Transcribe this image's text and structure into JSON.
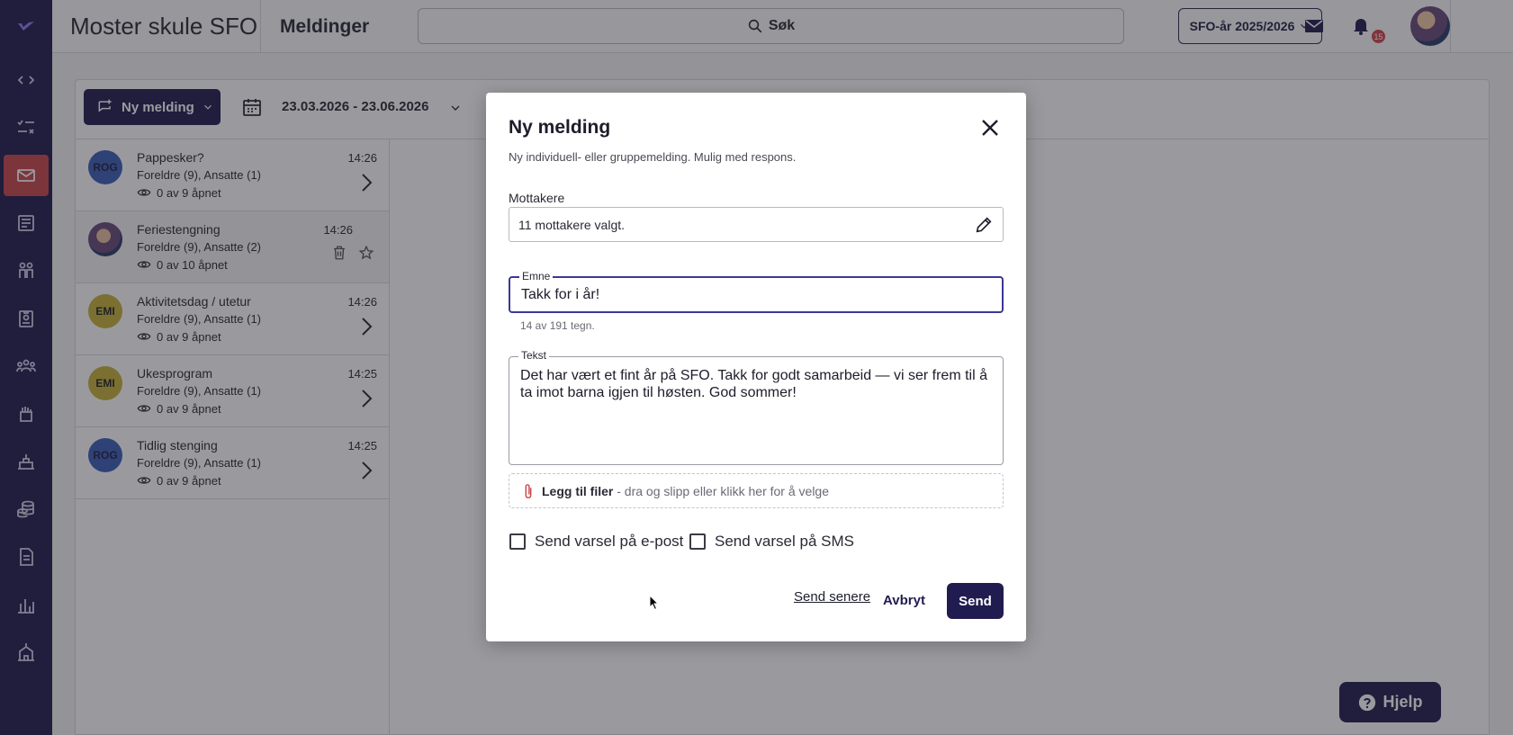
{
  "colors": {
    "sidebar": "#211c4f",
    "active_nav": "#c9474c",
    "primary": "#211c4f",
    "badge": "#d4424d"
  },
  "sidebar": {
    "items": [
      {
        "name": "logo-icon"
      },
      {
        "name": "code-icon"
      },
      {
        "name": "tasks-icon"
      },
      {
        "name": "mail-icon",
        "active": true
      },
      {
        "name": "newspaper-icon"
      },
      {
        "name": "children-icon"
      },
      {
        "name": "badge-icon"
      },
      {
        "name": "groups-icon"
      },
      {
        "name": "hand-icon"
      },
      {
        "name": "activities-icon"
      },
      {
        "name": "coins-icon"
      },
      {
        "name": "document-icon"
      },
      {
        "name": "chart-icon"
      },
      {
        "name": "school-icon"
      }
    ]
  },
  "header": {
    "title": "Moster skule SFO",
    "section": "Meldinger",
    "search_label": "Søk",
    "year_selector": "SFO-år 2025/2026",
    "notification_count": "15"
  },
  "toolbar": {
    "new_message_label": "Ny melding",
    "date_range": "23.03.2026 - 23.06.2026"
  },
  "messages": [
    {
      "avatar": "ROG",
      "avatar_color": "#3d5fb8",
      "title": "Pappesker?",
      "recipients": "Foreldre (9), Ansatte (1)",
      "opened": "0 av 9 åpnet",
      "time": "14:26"
    },
    {
      "avatar": "",
      "avatar_color": "#6a4a7a",
      "title": "Feriestengning",
      "recipients": "Foreldre (9), Ansatte (2)",
      "opened": "0 av 10 åpnet",
      "time": "14:26"
    },
    {
      "avatar": "EMI",
      "avatar_color": "#c7b23a",
      "title": "Aktivitetsdag / utetur",
      "recipients": "Foreldre (9), Ansatte (1)",
      "opened": "0 av 9 åpnet",
      "time": "14:26"
    },
    {
      "avatar": "EMI",
      "avatar_color": "#c7b23a",
      "title": "Ukesprogram",
      "recipients": "Foreldre (9), Ansatte (1)",
      "opened": "0 av 9 åpnet",
      "time": "14:25"
    },
    {
      "avatar": "ROG",
      "avatar_color": "#3d5fb8",
      "title": "Tidlig stenging",
      "recipients": "Foreldre (9), Ansatte (1)",
      "opened": "0 av 9 åpnet",
      "time": "14:25"
    }
  ],
  "help_label": "Hjelp",
  "modal": {
    "title": "Ny melding",
    "subtitle": "Ny individuell- eller gruppemelding. Mulig med respons.",
    "recipients_label": "Mottakere",
    "recipients_value": "11 mottakere valgt.",
    "subject_label": "Emne",
    "subject_value": "Takk for i år!",
    "char_counter": "14 av 191 tegn.",
    "text_label": "Tekst",
    "text_value": "Det har vært et fint år på SFO. Takk for godt samarbeid — vi ser frem til å ta imot barna igjen til høsten. God sommer!",
    "attach_bold": "Legg til filer",
    "attach_hint": "- dra og slipp eller klikk her for å velge",
    "email_notify_label": "Send varsel på e-post",
    "email_notify_checked": false,
    "sms_notify_label": "Send varsel på SMS",
    "sms_notify_checked": false,
    "send_later_label": "Send senere",
    "cancel_label": "Avbryt",
    "send_label": "Send"
  }
}
